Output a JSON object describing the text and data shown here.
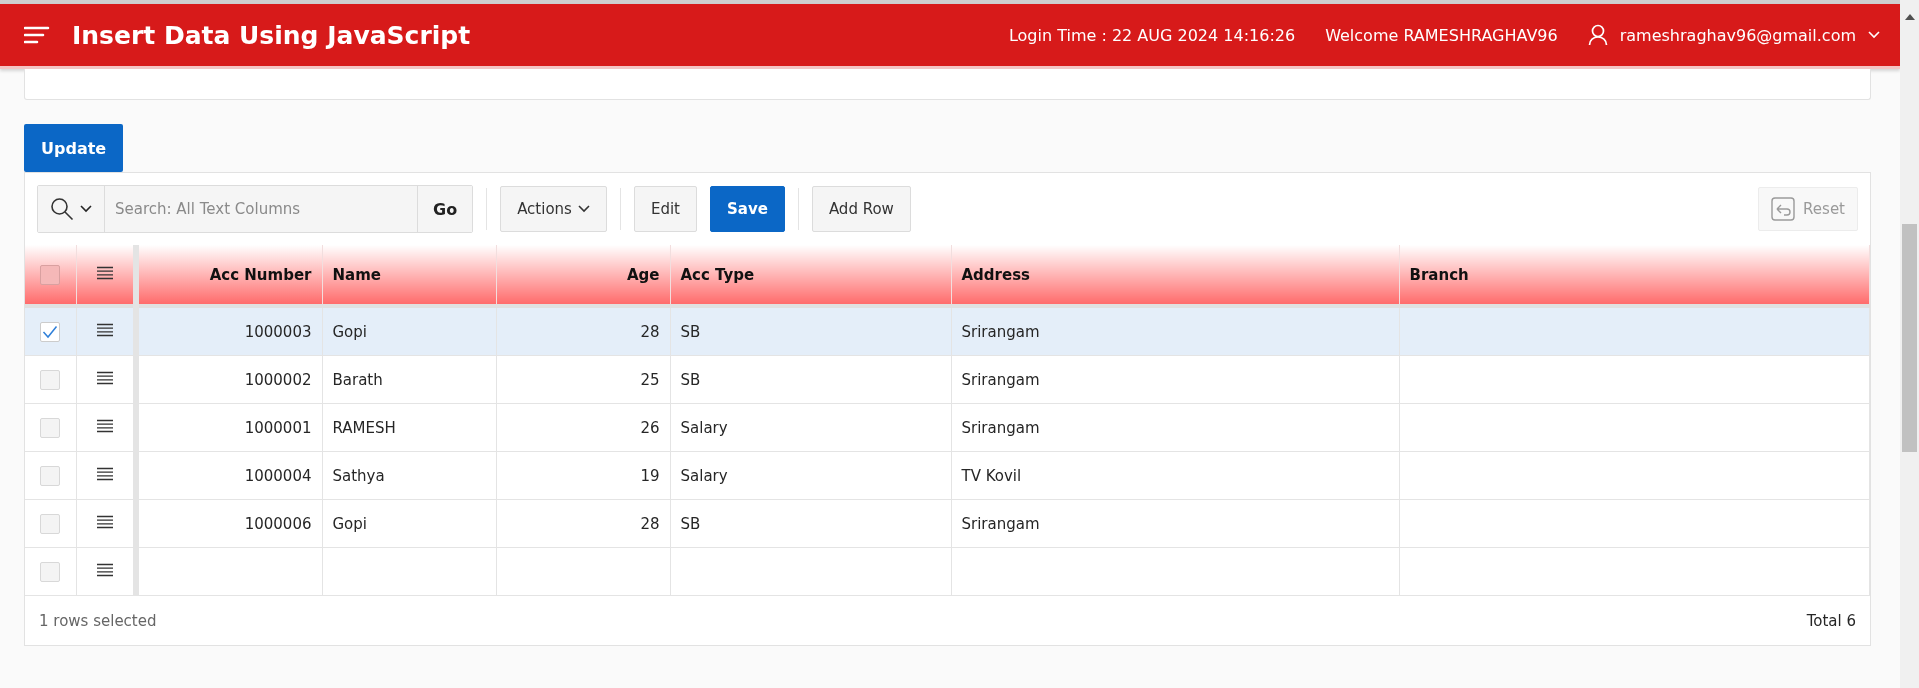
{
  "header": {
    "title": "Insert Data Using JavaScript",
    "login_time": "Login Time : 22 AUG 2024 14:16:26",
    "welcome": "Welcome RAMESHRAGHAV96",
    "user": "rameshraghav96@gmail.com"
  },
  "update_button": "Update",
  "toolbar": {
    "search_placeholder": "Search: All Text Columns",
    "go": "Go",
    "actions": "Actions",
    "buttons": [
      {
        "label": "Edit",
        "kind": "default"
      },
      {
        "label": "Save",
        "kind": "primary"
      },
      {
        "label": "Add Row",
        "kind": "default"
      }
    ],
    "reset": {
      "label": "Reset",
      "disabled": true
    }
  },
  "grid": {
    "select_all_checked": false,
    "columns": [
      {
        "label": "Acc Number",
        "kind": "number"
      },
      {
        "label": "Name",
        "kind": "text"
      },
      {
        "label": "Age",
        "kind": "number"
      },
      {
        "label": "Acc Type",
        "kind": "text"
      },
      {
        "label": "Address",
        "kind": "text"
      },
      {
        "label": "Branch",
        "kind": "text"
      }
    ],
    "blank_row": {
      "selected": false
    },
    "rows": [
      {
        "selected": true,
        "cells": [
          "1000003",
          "Gopi",
          "28",
          "SB",
          "Srirangam",
          ""
        ]
      },
      {
        "selected": false,
        "cells": [
          "1000002",
          "Barath",
          "25",
          "SB",
          "Srirangam",
          ""
        ]
      },
      {
        "selected": false,
        "cells": [
          "1000001",
          "RAMESH",
          "26",
          "Salary",
          "Srirangam",
          ""
        ]
      },
      {
        "selected": false,
        "cells": [
          "1000004",
          "Sathya",
          "19",
          "Salary",
          "TV Kovil",
          ""
        ]
      },
      {
        "selected": false,
        "cells": [
          "1000006",
          "Gopi",
          "28",
          "SB",
          "Srirangam",
          ""
        ]
      }
    ],
    "footer_left": "1 rows selected",
    "footer_right": "Total 6"
  }
}
